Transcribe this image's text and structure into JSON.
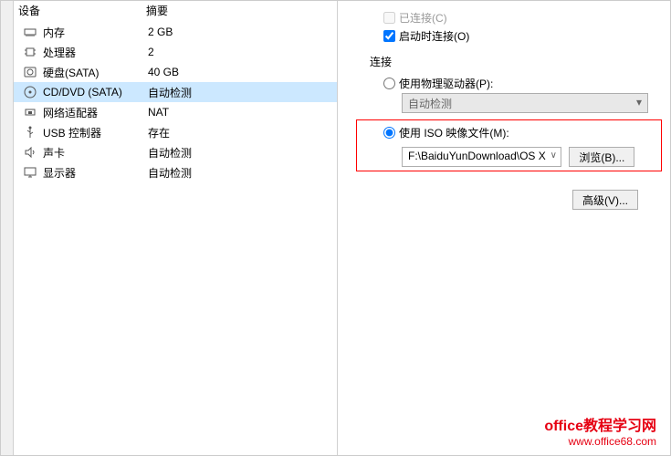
{
  "headers": {
    "device": "设备",
    "summary": "摘要"
  },
  "devices": [
    {
      "name": "内存",
      "value": "2 GB",
      "icon": "memory"
    },
    {
      "name": "处理器",
      "value": "2",
      "icon": "cpu"
    },
    {
      "name": "硬盘(SATA)",
      "value": "40 GB",
      "icon": "disk"
    },
    {
      "name": "CD/DVD (SATA)",
      "value": "自动检测",
      "icon": "cd",
      "selected": true
    },
    {
      "name": "网络适配器",
      "value": "NAT",
      "icon": "network"
    },
    {
      "name": "USB 控制器",
      "value": "存在",
      "icon": "usb"
    },
    {
      "name": "声卡",
      "value": "自动检测",
      "icon": "sound"
    },
    {
      "name": "显示器",
      "value": "自动检测",
      "icon": "display"
    }
  ],
  "deviceStatus": {
    "connected": "已连接(C)",
    "connectOnStart": "启动时连接(O)"
  },
  "connection": {
    "groupLabel": "连接",
    "usePhysical": "使用物理驱动器(P):",
    "autoDetect": "自动检测",
    "useIso": "使用 ISO 映像文件(M):",
    "isoPath": "F:\\BaiduYunDownload\\OS X",
    "browse": "浏览(B)..."
  },
  "buttons": {
    "advanced": "高级(V)..."
  },
  "watermark": {
    "title": "office教程学习网",
    "url": "www.office68.com"
  }
}
